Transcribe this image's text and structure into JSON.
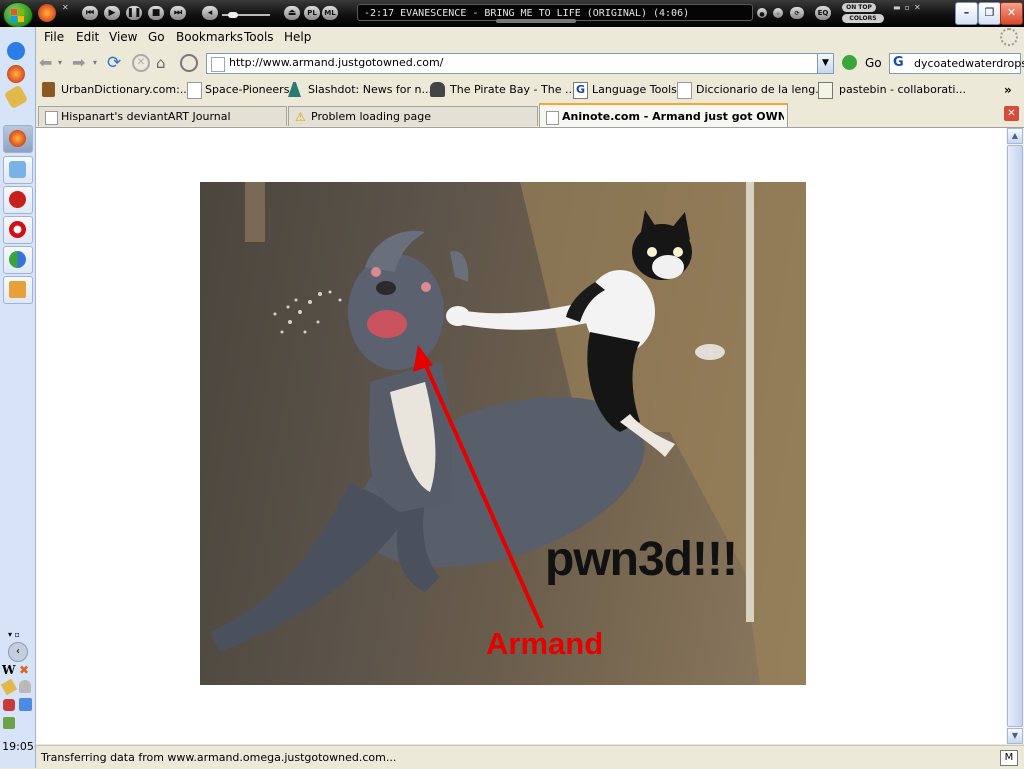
{
  "player": {
    "track_text": "-2:17  EVANESCENCE - BRING ME TO LIFE (ORIGINAL) (4:06)",
    "pl_label": "PL",
    "ml_label": "ML",
    "eq_label": "EQ",
    "ontop_label": "ON TOP",
    "colors_label": "COLORS"
  },
  "browser": {
    "menu": [
      "File",
      "Edit",
      "View",
      "Go",
      "Bookmarks",
      "Tools",
      "Help"
    ],
    "url": "http://www.armand.justgotowned.com/",
    "go_label": "Go",
    "search_value": "dycoatedwaterdrops",
    "bookmarks": [
      "UrbanDictionary.com:...",
      "Space-Pioneers",
      "Slashdot: News for n...",
      "The Pirate Bay - The ...",
      "Language Tools",
      "Diccionario de la leng...",
      "pastebin - collaborati..."
    ],
    "tabs": [
      "Hispanart's deviantART Journal",
      "Problem loading page",
      "Aninote.com - Armand just got OWNE..."
    ],
    "active_tab_index": 2,
    "status": "Transferring data from www.armand.omega.justgotowned.com..."
  },
  "image": {
    "caption_big": "pwn3d!!!",
    "caption_name": "Armand"
  },
  "taskbar": {
    "clock": "19:05"
  },
  "colors": {
    "accent_red": "#e60000",
    "tab_accent": "#f3a536"
  }
}
